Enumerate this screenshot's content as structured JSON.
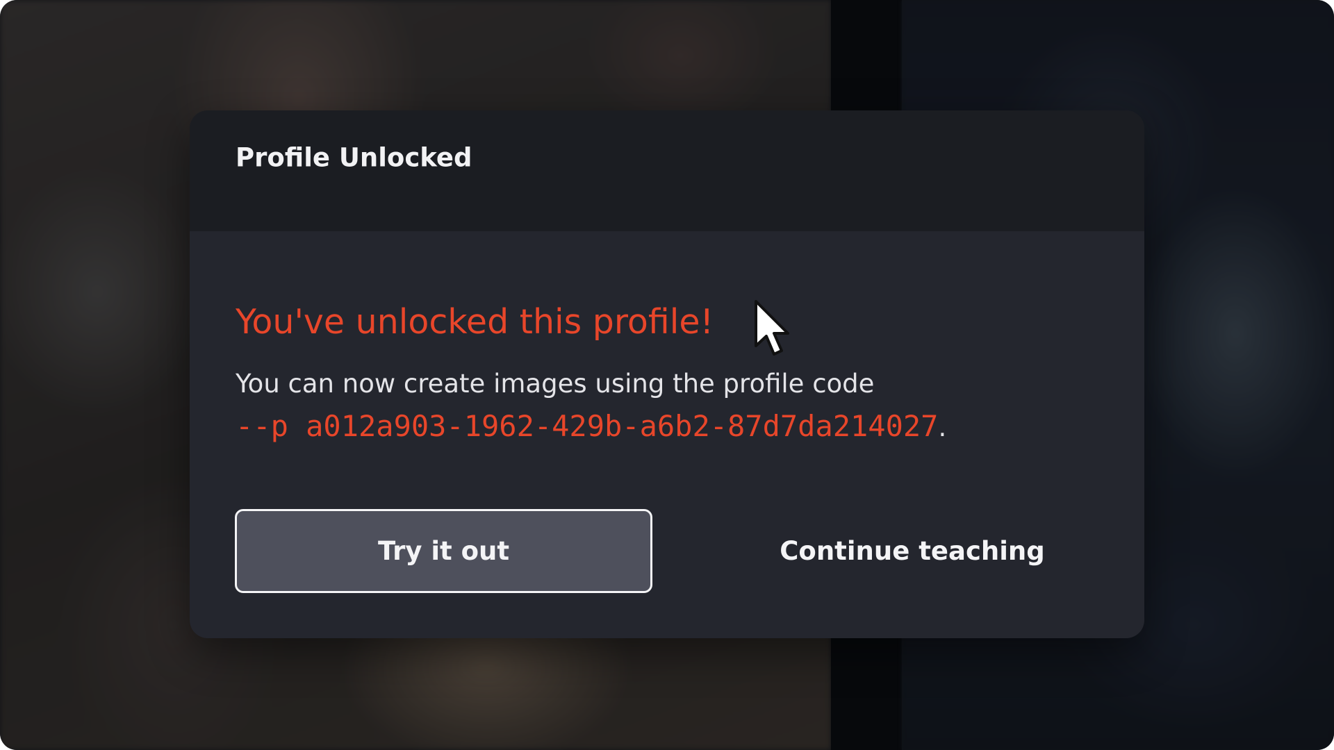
{
  "dialog": {
    "title": "Profile Unlocked",
    "headline": "You've unlocked this profile!",
    "body": "You can now create images using the profile code",
    "profile_code": "--p a012a903-1962-429b-a6b2-87d7da214027",
    "code_suffix": ".",
    "primary_button_label": "Try it out",
    "secondary_button_label": "Continue teaching"
  },
  "colors": {
    "accent": "#e8462a",
    "dialog_background": "#24262e",
    "header_background": "#1b1d22",
    "primary_button_background": "#4e505c"
  },
  "icons": {
    "cursor": "mouse-pointer-icon"
  }
}
